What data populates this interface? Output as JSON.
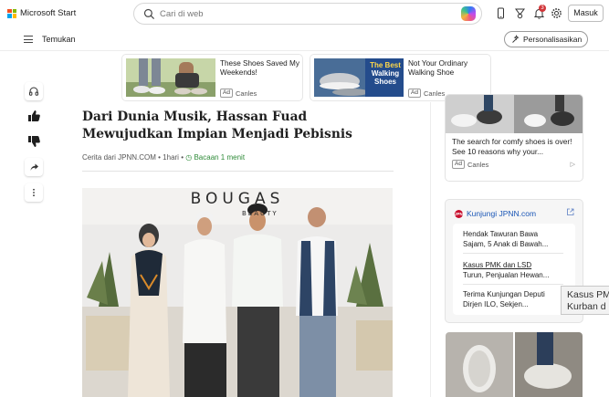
{
  "header": {
    "brand": "Microsoft Start",
    "search_placeholder": "Cari di web",
    "notification_count": "3",
    "signin_label": "Masuk",
    "brand_colors": [
      "#f25022",
      "#7fba00",
      "#00a4ef",
      "#ffb900"
    ]
  },
  "nav": {
    "menu_label": "Temukan",
    "personalize_label": "Personalisasikan"
  },
  "top_ads": [
    {
      "text": "These Shoes Saved My Weekends!",
      "ad_label": "Ad",
      "advertiser": "Canles"
    },
    {
      "text": "Not Your Ordinary Walking Shoe",
      "ad_label": "Ad",
      "advertiser": "Canles",
      "overlay": [
        "The Best",
        "Walking",
        "Shoes"
      ]
    }
  ],
  "rail": {
    "icons": [
      "headphones-icon",
      "thumbs-up-icon",
      "thumbs-down-icon",
      "share-icon",
      "more-icon"
    ]
  },
  "article": {
    "title": "Dari Dunia Musik, Hassan Fuad Mewujudkan Impian Menjadi Pebisnis",
    "source": "Cerita dari JPNN.COM",
    "age": "1hari",
    "read_time": "Bacaan 1 menit",
    "photo_sign": "BOUGAS",
    "photo_sign_sub": "BEAUTY"
  },
  "sidebar": {
    "ad_card": {
      "caption": "The search for comfy shoes is over! See 10 reasons why your...",
      "ad_label": "Ad",
      "advertiser": "Canles"
    },
    "jpnn": {
      "logo_text": "JPNN",
      "header": "Kunjungi JPNN.com",
      "items": [
        {
          "line1": "Hendak Tawuran Bawa",
          "line2": "Sajam, 5 Anak di Bawah..."
        },
        {
          "line1": "Kasus PMK dan LSD",
          "line2": "Turun, Penjualan Hewan..."
        },
        {
          "line1": "Terima Kunjungan Deputi",
          "line2": "Dirjen ILO, Sekjen..."
        }
      ]
    },
    "tooltip": [
      "Kasus PM",
      "Kurban d"
    ]
  }
}
